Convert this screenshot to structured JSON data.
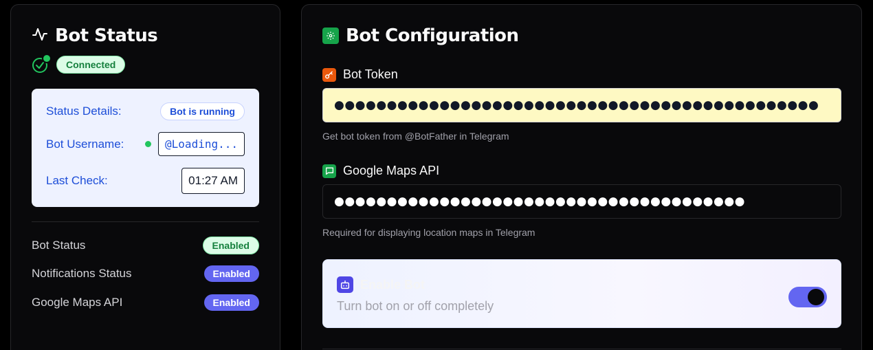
{
  "status_panel": {
    "title": "Bot Status",
    "connection_badge": "Connected",
    "details": {
      "status_label": "Status Details:",
      "status_value": "Bot is running",
      "username_label": "Bot Username:",
      "username_value": "@Loading...",
      "last_check_label": "Last Check:",
      "last_check_value": "01:27 AM"
    },
    "summary": [
      {
        "label": "Bot Status",
        "badge": "Enabled",
        "color": "#dcfce7"
      },
      {
        "label": "Notifications Status",
        "badge": "Enabled",
        "color": "#6366f1"
      },
      {
        "label": "Google Maps API",
        "badge": "Enabled",
        "color": "#6366f1"
      }
    ]
  },
  "config_panel": {
    "title": "Bot Configuration",
    "bot_token": {
      "label": "Bot Token",
      "value": "●●●●●●●●●●●●●●●●●●●●●●●●●●●●●●●●●●●●●●●●●●●●●●",
      "hint": "Get bot token from @BotFather in Telegram"
    },
    "maps_api": {
      "label": "Google Maps API",
      "value": "●●●●●●●●●●●●●●●●●●●●●●●●●●●●●●●●●●●●●●●",
      "hint": "Required for displaying location maps in Telegram"
    },
    "enable_bot": {
      "title": "Enable Bot",
      "description": "Turn bot on or off completely",
      "enabled": true
    }
  },
  "colors": {
    "background": "#000000",
    "card": "#09090b",
    "accent": "#6366f1",
    "success": "#22c55e",
    "token_input_bg": "#fef9c3"
  },
  "icons": {
    "status_title": "activity-icon",
    "connection": "check-circle-icon",
    "config_title": "gear-icon",
    "bot_token": "key-icon",
    "maps_api": "message-square-icon",
    "enable_bot": "bot-icon"
  }
}
